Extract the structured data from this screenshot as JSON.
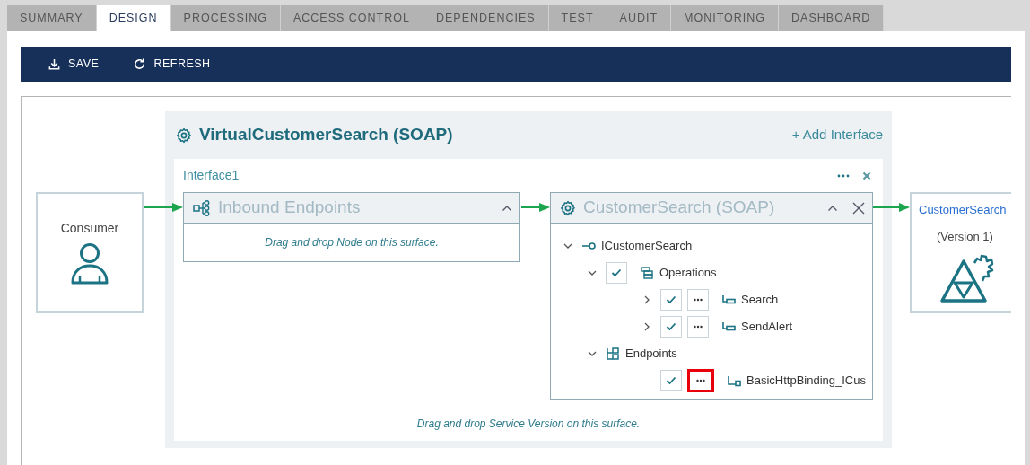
{
  "tabs": [
    {
      "label": "SUMMARY",
      "selected": false
    },
    {
      "label": "DESIGN",
      "selected": true
    },
    {
      "label": "PROCESSING",
      "selected": false
    },
    {
      "label": "ACCESS CONTROL",
      "selected": false
    },
    {
      "label": "DEPENDENCIES",
      "selected": false
    },
    {
      "label": "TEST",
      "selected": false
    },
    {
      "label": "AUDIT",
      "selected": false
    },
    {
      "label": "MONITORING",
      "selected": false
    },
    {
      "label": "DASHBOARD",
      "selected": false
    }
  ],
  "toolbar": [
    {
      "kind": "save",
      "label": "SAVE"
    },
    {
      "kind": "refresh",
      "label": "REFRESH"
    }
  ],
  "consumer": {
    "label": "Consumer"
  },
  "service": {
    "title": "VirtualCustomerSearch (SOAP)",
    "add_label": "+ Add Interface",
    "interface": {
      "name": "Interface1",
      "inbound": {
        "title": "Inbound Endpoints",
        "hint": "Drag and drop Node on this surface.",
        "expanded": true
      },
      "version": {
        "title": "CustomerSearch (SOAP)",
        "expanded": true,
        "tree": [
          {
            "label": "ICustomerSearch",
            "kind": "interface",
            "expanded": true,
            "children": [
              {
                "label": "Operations",
                "kind": "operations",
                "expanded": true,
                "checked": true,
                "children": [
                  {
                    "label": "Search",
                    "kind": "operation",
                    "expanded": false,
                    "checked": true,
                    "menu": true,
                    "highlighted": false
                  },
                  {
                    "label": "SendAlert",
                    "kind": "operation",
                    "expanded": false,
                    "checked": true,
                    "menu": true,
                    "highlighted": false
                  }
                ]
              },
              {
                "label": "Endpoints",
                "kind": "endpoints",
                "expanded": true,
                "children": [
                  {
                    "label": "BasicHttpBinding_ICus",
                    "kind": "endpoint",
                    "checked": true,
                    "menu": true,
                    "highlighted": true
                  }
                ]
              }
            ]
          }
        ]
      },
      "hint": "Drag and drop Service Version on this surface."
    }
  },
  "target": {
    "name": "CustomerSearch",
    "version": "(Version 1)"
  }
}
